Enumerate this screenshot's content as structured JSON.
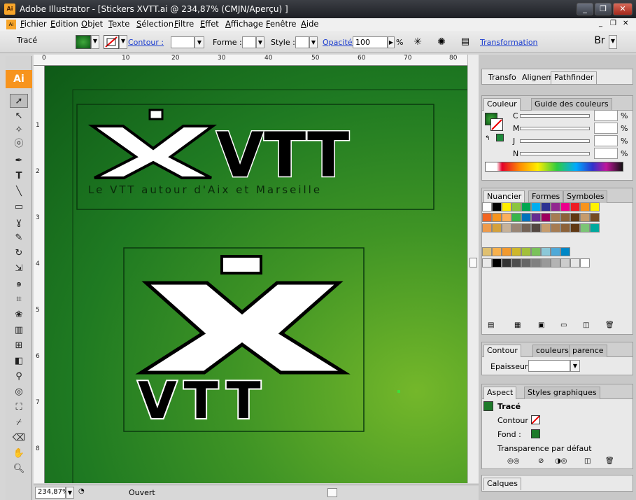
{
  "window": {
    "title": "Adobe Illustrator - [Stickers XVTT.ai @ 234,87% (CMJN/Aperçu) ]",
    "app_icon": "Ai",
    "min": "_",
    "restore": "❐",
    "close": "✕"
  },
  "menu": [
    {
      "label": "Fichier"
    },
    {
      "label": "Edition"
    },
    {
      "label": "Objet"
    },
    {
      "label": "Texte"
    },
    {
      "label": "Sélection"
    },
    {
      "label": "Filtre"
    },
    {
      "label": "Effet"
    },
    {
      "label": "Affichage"
    },
    {
      "label": "Fenêtre"
    },
    {
      "label": "Aide"
    }
  ],
  "control": {
    "selection": "Tracé",
    "contour": "Contour :",
    "forme": "Forme :",
    "style": "Style :",
    "opacite": "Opacité :",
    "opacity_value": "100",
    "pct": "%",
    "transformation": "Transformation"
  },
  "ruler_h": [
    "0",
    "10",
    "20",
    "30",
    "40",
    "50",
    "60",
    "70",
    "80"
  ],
  "ruler_v": [
    "1",
    "2",
    "3",
    "4",
    "5",
    "6",
    "7",
    "8"
  ],
  "artwork": {
    "logo1_text": "VTT",
    "logo1_tagline": "Le VTT autour d'Aix et Marseille",
    "logo2_text": "VTT",
    "logo_x": "X",
    "fill": "#000000",
    "bg_accent": "#2a8a24"
  },
  "status": {
    "zoom": "234,87%",
    "state": "Ouvert"
  },
  "panels": {
    "top_tabs": [
      "Transfo",
      "Alignem",
      "Pathfinder"
    ],
    "couleur": {
      "tabs": [
        "Couleur",
        "Guide des couleurs"
      ],
      "channels": [
        "C",
        "M",
        "J",
        "N"
      ],
      "pct": "%"
    },
    "nuancier": {
      "tabs": [
        "Nuancier",
        "Formes",
        "Symboles"
      ]
    },
    "contour": {
      "tabs": [
        "Contour",
        "couleurs",
        "parence"
      ],
      "epaisseur": "Epaisseur :"
    },
    "aspect": {
      "tabs": [
        "Aspect",
        "Styles graphiques"
      ],
      "item": "Tracé",
      "contour": "Contour :",
      "fond": "Fond :",
      "transparence": "Transparence par défaut"
    },
    "calques": {
      "tabs": [
        "Calques"
      ]
    }
  },
  "colors": {
    "swatch_rows": [
      [
        "#ffffff",
        "#000000",
        "#ffed00",
        "#8bc53f",
        "#00a651",
        "#00aeef",
        "#2e3192",
        "#92278f",
        "#ec008c",
        "#ed1c24",
        "#f7941d",
        "#fff200"
      ],
      [
        "#f26522",
        "#f7941d",
        "#fbaf5d",
        "#39b54a",
        "#0072bc",
        "#662d91",
        "#9e005d",
        "#a67c52",
        "#8c6239",
        "#603813",
        "#c69c6d",
        "#754c24"
      ],
      [
        "#ee9a4a",
        "#d4a13c",
        "#c7b299",
        "#998675",
        "#736357",
        "#534741",
        "#c69c6d",
        "#a67c52",
        "#8c6239",
        "#603813",
        "#7cc576",
        "#00a99d"
      ]
    ]
  }
}
